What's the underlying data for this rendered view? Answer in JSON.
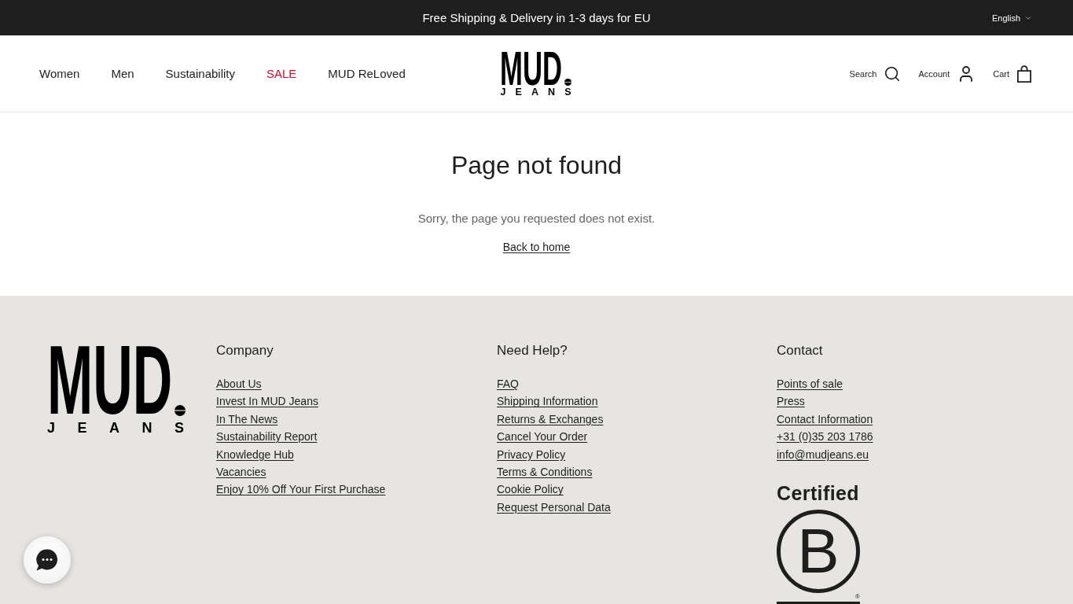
{
  "announcement_bar": {
    "message": "Free Shipping & Delivery in 1-3 days for EU",
    "language": "English"
  },
  "header": {
    "nav": [
      {
        "label": "Women",
        "color": "#1e1e1e"
      },
      {
        "label": "Men",
        "color": "#1e1e1e"
      },
      {
        "label": "Sustainability",
        "color": "#1e1e1e"
      },
      {
        "label": "SALE",
        "color": "#c4122f"
      },
      {
        "label": "MUD ReLoved",
        "color": "#1e1e1e"
      }
    ],
    "logo": {
      "wordmark": "MUD",
      "tagline": "JEANS"
    },
    "actions": [
      {
        "label": "Search",
        "kind": "search"
      },
      {
        "label": "Account",
        "kind": "account"
      },
      {
        "label": "Cart",
        "kind": "cart"
      }
    ]
  },
  "not_found": {
    "title": "Page not found",
    "message": "Sorry, the page you requested does not exist.",
    "link": "Back to home"
  },
  "footer": {
    "logo": {
      "wordmark": "MUD",
      "tagline": "JEANS"
    },
    "columns": [
      {
        "heading": "Company",
        "links": [
          "About Us",
          "Invest In MUD Jeans",
          "In The News",
          "Sustainability Report",
          "Knowledge Hub",
          "Vacancies",
          "Enjoy 10% Off Your First Purchase"
        ]
      },
      {
        "heading": "Need Help?",
        "links": [
          "FAQ",
          "Shipping Information",
          "Returns & Exchanges",
          "Cancel Your Order",
          "Privacy Policy",
          "Terms & Conditions",
          "Cookie Policy",
          "Request Personal Data"
        ]
      },
      {
        "heading": "Contact",
        "links": [
          "Points of sale",
          "Press",
          "Contact Information",
          "+31 (0)35 203 1786",
          "info@mudjeans.eu"
        ]
      }
    ],
    "certification": {
      "label": "Certified",
      "letter": "B",
      "registered": "®"
    }
  }
}
